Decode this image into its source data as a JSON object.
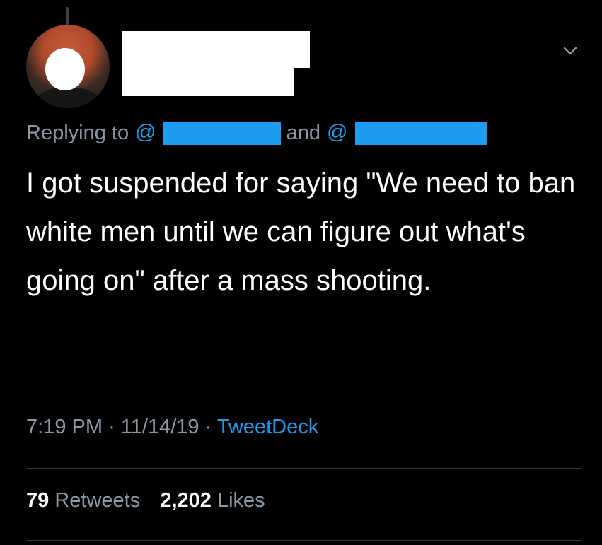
{
  "tweet": {
    "reply": {
      "prefix": "Replying to",
      "at_1": "@",
      "conjunction": "and",
      "at_2": "@"
    },
    "text": "I got suspended for saying \"We need to ban white men until we can figure out what's going on\" after a mass shooting.",
    "meta": {
      "time": "7:19 PM",
      "date": "11/14/19",
      "separator": "·",
      "source": "TweetDeck"
    },
    "stats": {
      "retweets_count": "79",
      "retweets_label": "Retweets",
      "likes_count": "2,202",
      "likes_label": "Likes"
    }
  },
  "icons": {
    "menu": "chevron-down-icon",
    "avatar": "avatar"
  },
  "colors": {
    "background": "#000000",
    "primary_text": "#ffffff",
    "secondary_text": "#8b98a5",
    "link": "#1d9bf0",
    "divider": "#2f3336"
  }
}
